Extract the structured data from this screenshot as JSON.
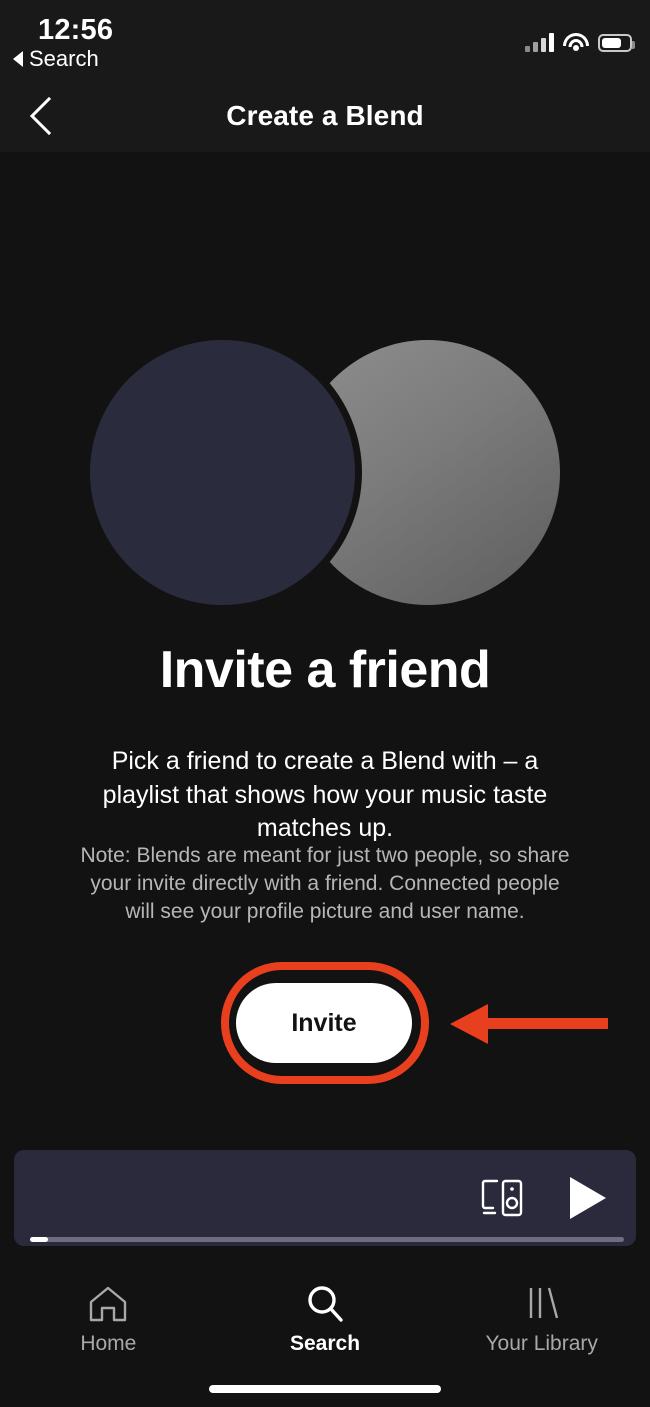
{
  "status_bar": {
    "time": "12:56",
    "back_app_label": "Search",
    "back_triangle_icon": "triangle-left-icon",
    "cellular_icon": "cellular-signal-icon",
    "wifi_icon": "wifi-icon",
    "battery_icon": "battery-icon"
  },
  "header": {
    "title": "Create a Blend",
    "back_icon": "chevron-left-icon"
  },
  "hero": {
    "left_circle_color": "#2b2b3e",
    "right_circle_color": "#7b7b7b",
    "add_icon": "plus-icon"
  },
  "content": {
    "headline": "Invite a friend",
    "subtitle": "Pick a friend to create a Blend with – a playlist that shows how your music taste matches up.",
    "note": "Note: Blends are meant for just two people, so share your invite directly with a friend. Connected people will see your profile picture and user name."
  },
  "cta": {
    "invite_label": "Invite",
    "highlight_color": "#e8401f",
    "arrow_icon": "arrow-left-icon"
  },
  "now_playing": {
    "background_color": "#2b2a3d",
    "devices_icon": "devices-connect-icon",
    "play_icon": "play-icon",
    "progress_percent": 3
  },
  "tab_bar": {
    "tabs": [
      {
        "label": "Home",
        "icon": "home-icon",
        "active": false
      },
      {
        "label": "Search",
        "icon": "search-icon",
        "active": true
      },
      {
        "label": "Your Library",
        "icon": "library-icon",
        "active": false
      }
    ]
  }
}
